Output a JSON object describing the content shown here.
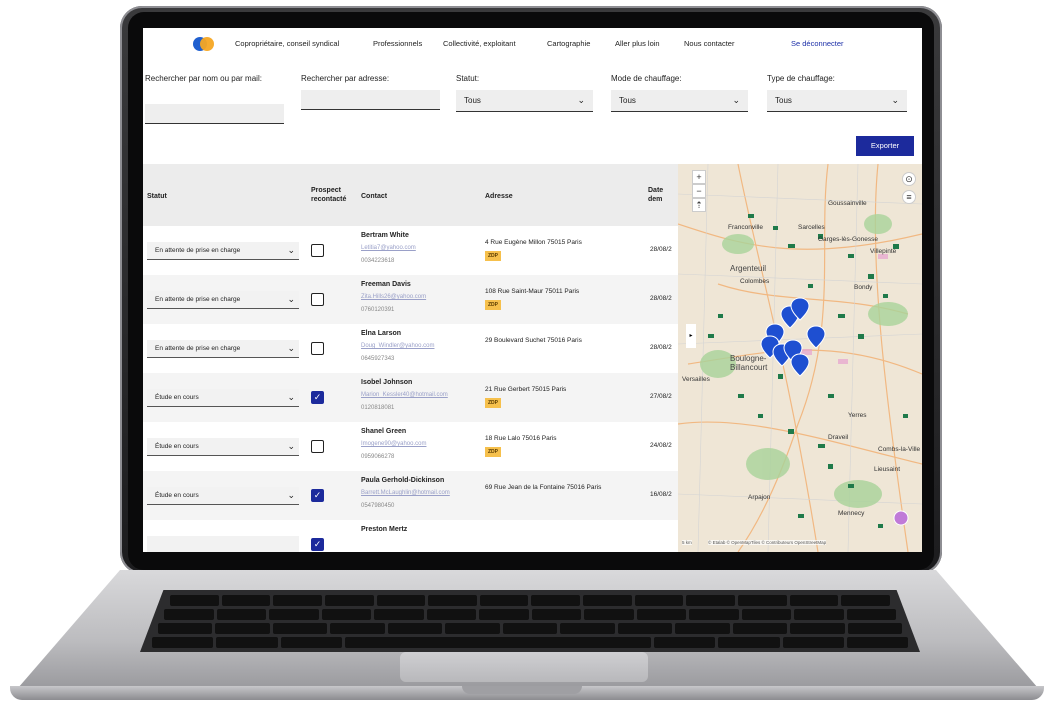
{
  "nav": {
    "items": [
      "Copropriétaire, conseil syndical",
      "Professionnels",
      "Collectivité, exploitant",
      "Cartographie",
      "Aller plus loin",
      "Nous contacter"
    ],
    "logout": "Se déconnecter"
  },
  "filters": {
    "search_name_label": "Rechercher par nom ou par mail:",
    "search_address_label": "Rechercher par adresse:",
    "statut_label": "Statut:",
    "statut_value": "Tous",
    "heating_mode_label": "Mode de chauffage:",
    "heating_mode_value": "Tous",
    "heating_type_label": "Type de chauffage:",
    "heating_type_value": "Tous"
  },
  "export_label": "Exporter",
  "table": {
    "headers": {
      "statut": "Statut",
      "prospect": "Prospect recontacté",
      "contact": "Contact",
      "address": "Adresse",
      "date": "Date dem"
    },
    "rows": [
      {
        "statut": "En attente de prise en charge",
        "recontacted": false,
        "name": "Bertram White",
        "email": "Letitia7@yahoo.com",
        "phone": "0034223618",
        "address": "4 Rue Eugène Millon 75015 Paris",
        "zdp": "ZDP",
        "date": "28/08/2"
      },
      {
        "statut": "En attente de prise en charge",
        "recontacted": false,
        "name": "Freeman Davis",
        "email": "Zita.Hills26@yahoo.com",
        "phone": "0760120391",
        "address": "108 Rue Saint-Maur 75011 Paris",
        "zdp": "ZDP",
        "date": "28/08/2"
      },
      {
        "statut": "En attente de prise en charge",
        "recontacted": false,
        "name": "Elna Larson",
        "email": "Doug_Windler@yahoo.com",
        "phone": "0645927343",
        "address": "29 Boulevard Suchet 75016 Paris",
        "zdp": "",
        "date": "28/08/2"
      },
      {
        "statut": "Étude en cours",
        "recontacted": true,
        "name": "Isobel Johnson",
        "email": "Marion_Kessler40@hotmail.com",
        "phone": "0120818081",
        "address": "21 Rue Gerbert 75015 Paris",
        "zdp": "ZDP",
        "date": "27/08/2"
      },
      {
        "statut": "Étude en cours",
        "recontacted": false,
        "name": "Shanel Green",
        "email": "Imogene90@yahoo.com",
        "phone": "0959066278",
        "address": "18 Rue Lalo 75016 Paris",
        "zdp": "ZDP",
        "date": "24/08/2"
      },
      {
        "statut": "Étude en cours",
        "recontacted": true,
        "name": "Paula Gerhold-Dickinson",
        "email": "Barrett.McLaughlin@hotmail.com",
        "phone": "0547980450",
        "address": "69 Rue Jean de la Fontaine 75016 Paris",
        "zdp": "",
        "date": "16/08/2"
      },
      {
        "statut": "",
        "recontacted": true,
        "name": "Preston Mertz",
        "email": "",
        "phone": "",
        "address": "",
        "zdp": "",
        "date": ""
      }
    ]
  },
  "map": {
    "labels": [
      "Franconville",
      "Sarcelles",
      "Garges-lès-Gonesse",
      "Argenteuil",
      "Colombes",
      "Bondy",
      "Villepinte",
      "Boulogne-Billancourt",
      "Versailles",
      "Yerres",
      "Draveil",
      "Combs-la-Ville",
      "Lieusaint",
      "Arpajon",
      "Mennecy",
      "Goussainville"
    ],
    "attribution": "© Etalab © OpenMapTiles © Contributeurs OpenStreetMap",
    "scale": "5 km",
    "accent": "#1e4fd1"
  }
}
